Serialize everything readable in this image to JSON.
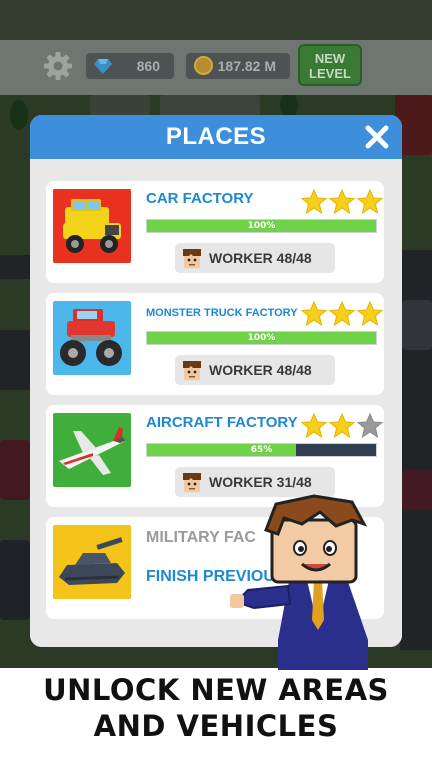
{
  "topbar": {
    "gems": "860",
    "coins": "187.82 M",
    "new_level_line1": "NEW",
    "new_level_line2": "LEVEL"
  },
  "panel": {
    "title": "PLACES",
    "places": [
      {
        "name": "CAR FACTORY",
        "stars": 3,
        "progress": 100,
        "progress_label": "100%",
        "worker": "WORKER 48/48",
        "locked": false
      },
      {
        "name": "MONSTER TRUCK FACTORY",
        "stars": 3,
        "progress": 100,
        "progress_label": "100%",
        "worker": "WORKER 48/48",
        "locked": false
      },
      {
        "name": "AIRCRAFT FACTORY",
        "stars": 2,
        "progress": 65,
        "progress_label": "65%",
        "worker": "WORKER 31/48",
        "locked": false
      },
      {
        "name": "MILITARY FAC",
        "subtitle": "FINISH PREVIOU",
        "locked": true
      }
    ]
  },
  "caption": {
    "line1": "UNLOCK NEW AREAS",
    "line2": "AND VEHICLES"
  },
  "colors": {
    "header": "#3d8fdc",
    "place_name": "#1e88d0",
    "progress_fill": "#6fd34a",
    "progress_empty": "#2f3f50",
    "star": "#f6cf1c",
    "star_empty": "#9a9a9a"
  },
  "icons": [
    "gear-icon",
    "gem-icon",
    "coin-icon",
    "close-icon",
    "star-icon",
    "worker-icon"
  ]
}
